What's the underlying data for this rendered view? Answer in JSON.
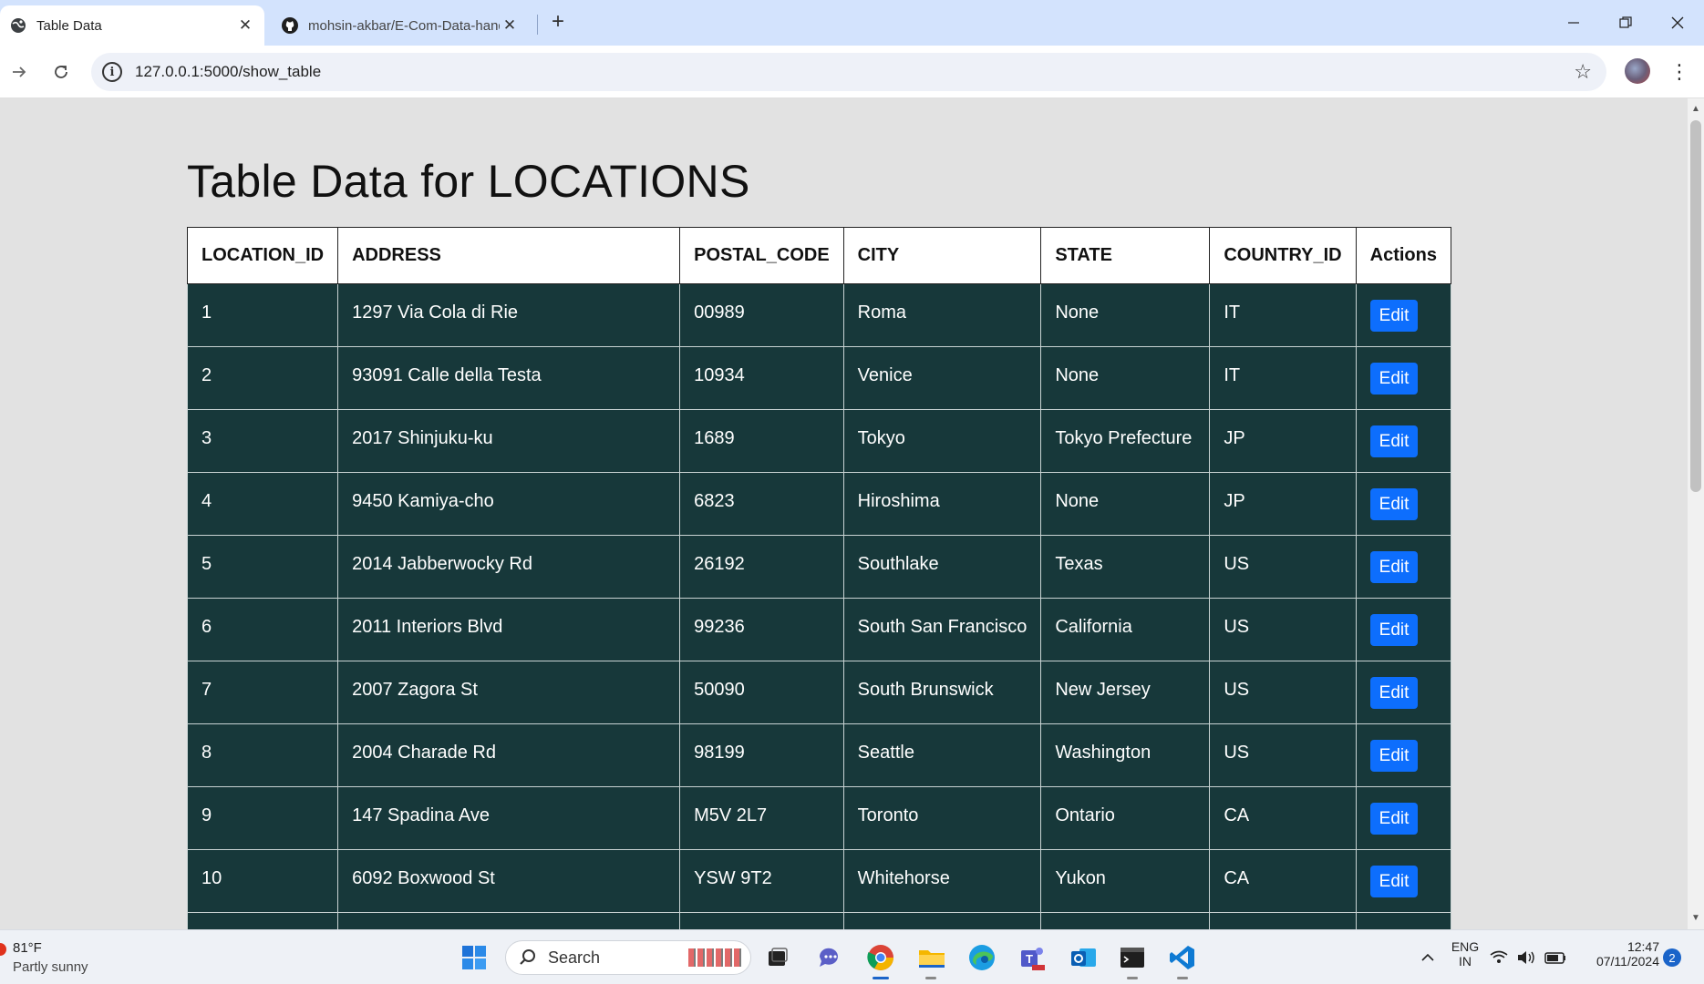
{
  "browser": {
    "tabs": [
      {
        "title": "Table Data",
        "active": true
      },
      {
        "title": "mohsin-akbar/E-Com-Data-handli",
        "active": false
      }
    ],
    "url": "127.0.0.1:5000/show_table"
  },
  "page": {
    "heading": "Table Data for LOCATIONS",
    "columns": [
      "LOCATION_ID",
      "ADDRESS",
      "POSTAL_CODE",
      "CITY",
      "STATE",
      "COUNTRY_ID",
      "Actions"
    ],
    "edit_label": "Edit",
    "rows": [
      {
        "location_id": "1",
        "address": "1297 Via Cola di Rie",
        "postal_code": "00989",
        "city": "Roma",
        "state": "None",
        "country_id": "IT"
      },
      {
        "location_id": "2",
        "address": "93091 Calle della Testa",
        "postal_code": "10934",
        "city": "Venice",
        "state": "None",
        "country_id": "IT"
      },
      {
        "location_id": "3",
        "address": "2017 Shinjuku-ku",
        "postal_code": "1689",
        "city": "Tokyo",
        "state": "Tokyo Prefecture",
        "country_id": "JP"
      },
      {
        "location_id": "4",
        "address": "9450 Kamiya-cho",
        "postal_code": "6823",
        "city": "Hiroshima",
        "state": "None",
        "country_id": "JP"
      },
      {
        "location_id": "5",
        "address": "2014 Jabberwocky Rd",
        "postal_code": "26192",
        "city": "Southlake",
        "state": "Texas",
        "country_id": "US"
      },
      {
        "location_id": "6",
        "address": "2011 Interiors Blvd",
        "postal_code": "99236",
        "city": "South San Francisco",
        "state": "California",
        "country_id": "US"
      },
      {
        "location_id": "7",
        "address": "2007 Zagora St",
        "postal_code": "50090",
        "city": "South Brunswick",
        "state": "New Jersey",
        "country_id": "US"
      },
      {
        "location_id": "8",
        "address": "2004 Charade Rd",
        "postal_code": "98199",
        "city": "Seattle",
        "state": "Washington",
        "country_id": "US"
      },
      {
        "location_id": "9",
        "address": "147 Spadina Ave",
        "postal_code": "M5V 2L7",
        "city": "Toronto",
        "state": "Ontario",
        "country_id": "CA"
      },
      {
        "location_id": "10",
        "address": "6092 Boxwood St",
        "postal_code": "YSW 9T2",
        "city": "Whitehorse",
        "state": "Yukon",
        "country_id": "CA"
      },
      {
        "location_id": "",
        "address": "",
        "postal_code": "",
        "city": "",
        "state": "",
        "country_id": ""
      }
    ]
  },
  "taskbar": {
    "weather_temp": "81°F",
    "weather_desc": "Partly sunny",
    "search_label": "Search",
    "lang_top": "ENG",
    "lang_bottom": "IN",
    "time": "12:47",
    "date": "07/11/2024",
    "notification_count": "2",
    "apps": [
      "windows-start",
      "search",
      "file-viewer",
      "chat",
      "chrome",
      "file-explorer",
      "edge",
      "teams",
      "outlook",
      "terminal",
      "vscode"
    ]
  },
  "colors": {
    "row_bg": "#17383a",
    "header_bg": "#ffffff",
    "edit_button": "#0d6efd",
    "page_bg": "#e2e2e2"
  }
}
